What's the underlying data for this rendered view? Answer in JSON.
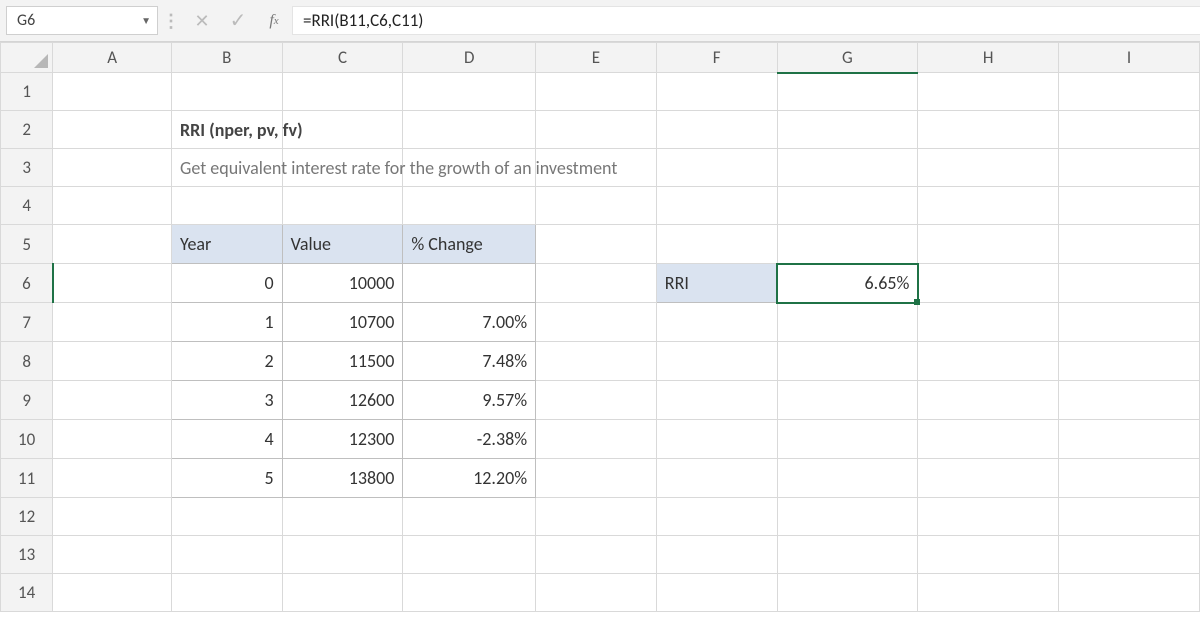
{
  "formula_bar": {
    "name_box": "G6",
    "formula": "=RRI(B11,C6,C11)"
  },
  "columns": [
    "A",
    "B",
    "C",
    "D",
    "E",
    "F",
    "G",
    "H",
    "I"
  ],
  "rows": [
    "1",
    "2",
    "3",
    "4",
    "5",
    "6",
    "7",
    "8",
    "9",
    "10",
    "11",
    "12",
    "13",
    "14"
  ],
  "active": {
    "col": "G",
    "row": "6"
  },
  "content": {
    "title": "RRI (nper, pv, fv)",
    "subtitle": "Get equivalent interest rate for the growth of an investment",
    "table_headers": {
      "year": "Year",
      "value": "Value",
      "change": "% Change"
    },
    "data": [
      {
        "year": "0",
        "value": "10000",
        "change": ""
      },
      {
        "year": "1",
        "value": "10700",
        "change": "7.00%"
      },
      {
        "year": "2",
        "value": "11500",
        "change": "7.48%"
      },
      {
        "year": "3",
        "value": "12600",
        "change": "9.57%"
      },
      {
        "year": "4",
        "value": "12300",
        "change": "-2.38%"
      },
      {
        "year": "5",
        "value": "13800",
        "change": "12.20%"
      }
    ],
    "rri_label": "RRI",
    "rri_value": "6.65%"
  }
}
